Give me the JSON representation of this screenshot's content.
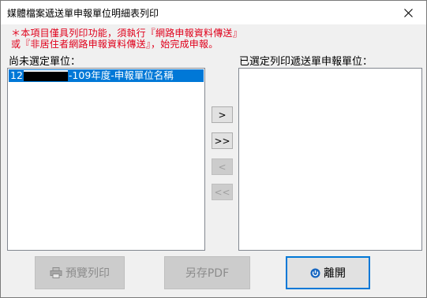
{
  "window": {
    "title": "媒體檔案遞送單申報單位明細表列印"
  },
  "notice": {
    "line1": "＊本項目僅具列印功能，須執行『網路申報資料傳送』",
    "line2": "或『非居住者網路申報資料傳送』，始完成申報。"
  },
  "left_list": {
    "label": "尚未選定單位：",
    "items": [
      {
        "prefix": "12",
        "suffix": "-109年度-申報單位名稱",
        "selected": true
      }
    ]
  },
  "right_list": {
    "label": "已選定列印遞送單申報單位：",
    "items": []
  },
  "move_buttons": {
    "add": ">",
    "add_all": ">>",
    "remove": "<",
    "remove_all": "<<"
  },
  "buttons": {
    "preview": "預覽列印",
    "save_pdf": "另存PDF",
    "exit": "離開"
  },
  "colors": {
    "notice": "#e0001b",
    "selection": "#0078d7",
    "focus_border": "#0078d7"
  },
  "icons": {
    "close": "close-icon",
    "print": "printer-icon",
    "exit": "power-icon"
  }
}
